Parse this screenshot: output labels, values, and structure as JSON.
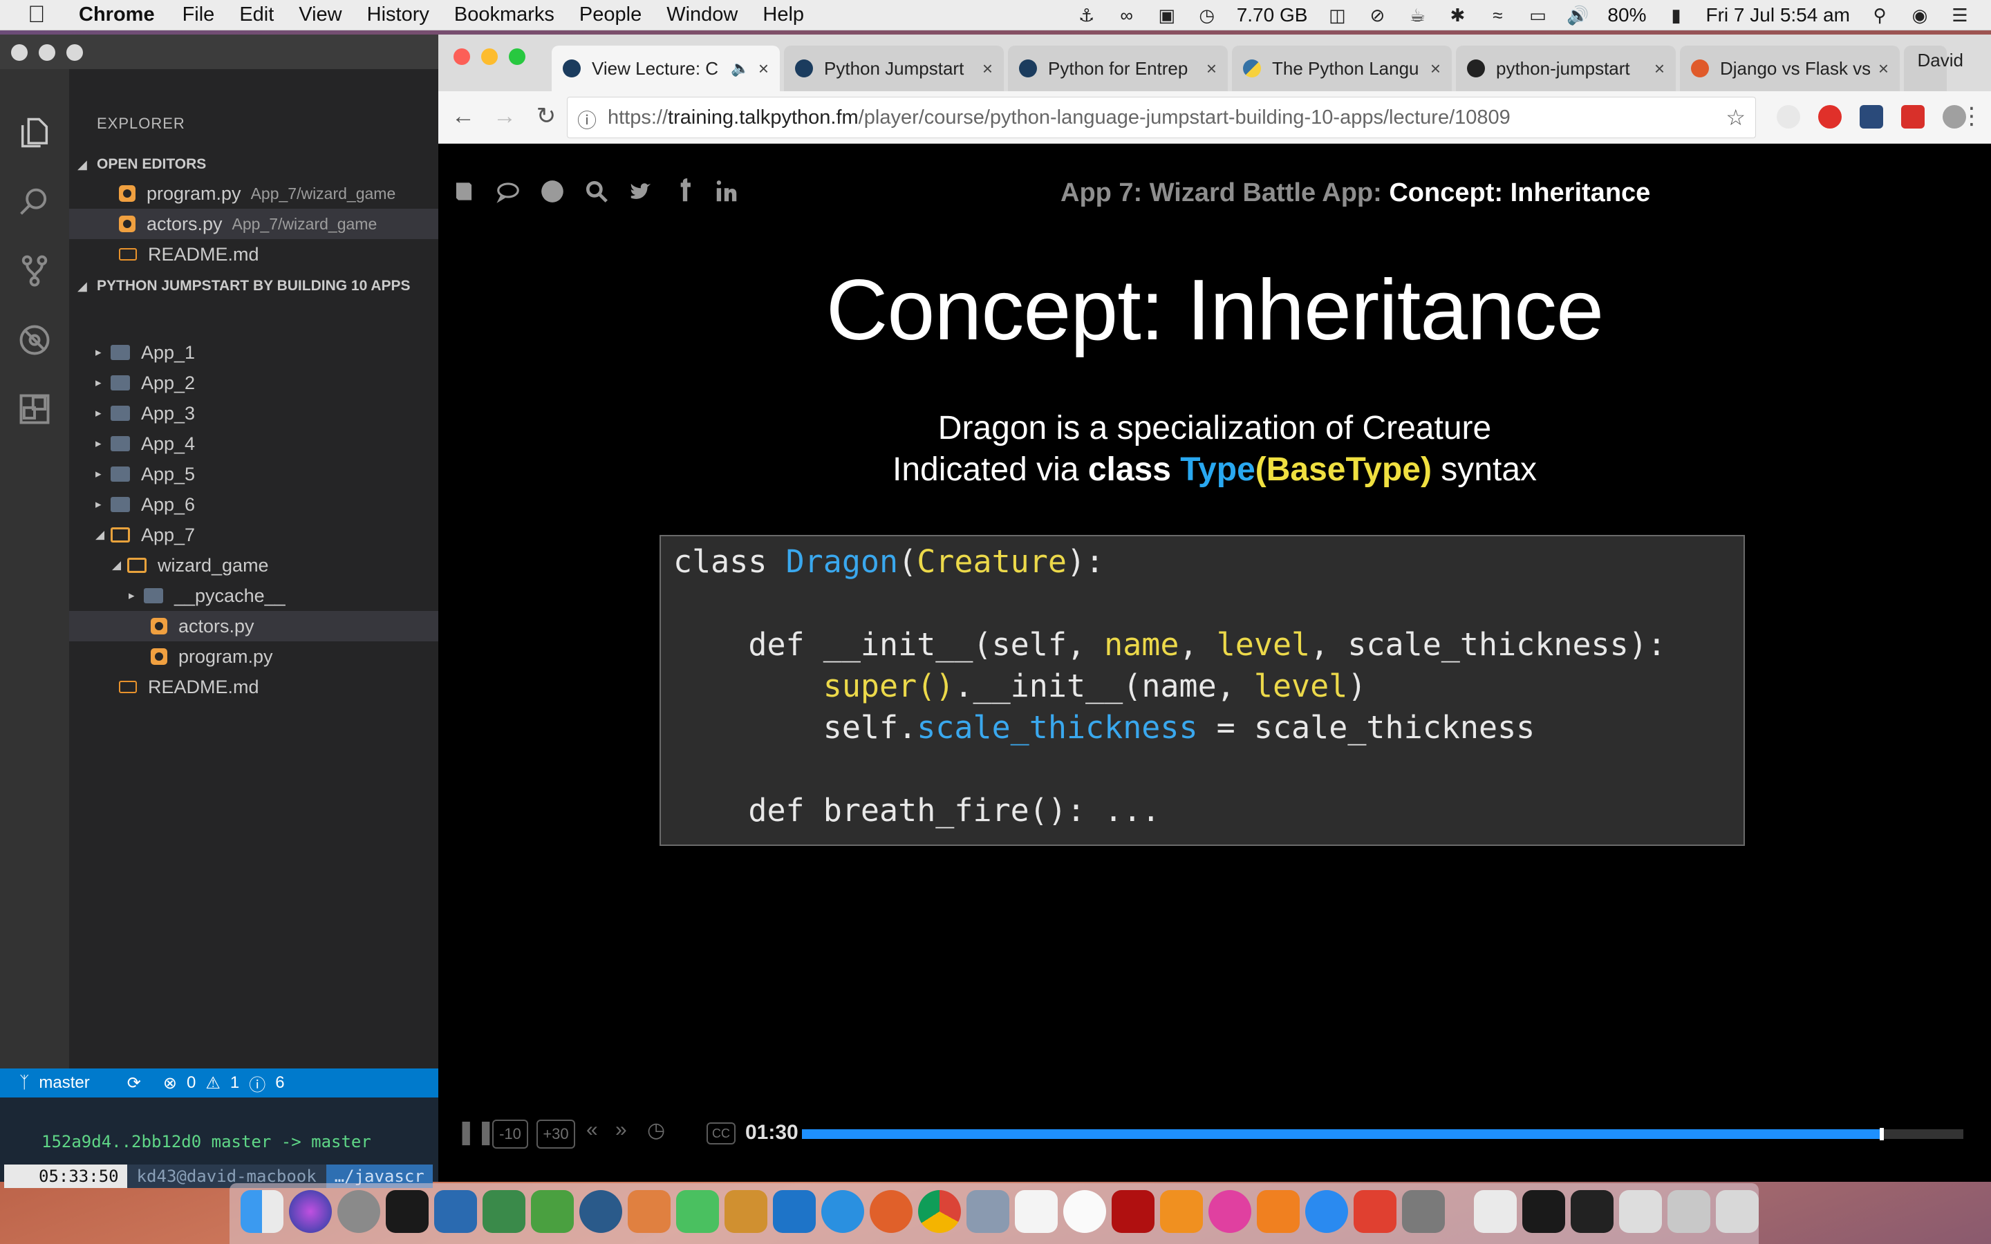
{
  "menubar": {
    "app_name": "Chrome",
    "menus": [
      "File",
      "Edit",
      "View",
      "History",
      "Bookmarks",
      "People",
      "Window",
      "Help"
    ],
    "memory": "7.70 GB",
    "battery": "80%",
    "clock": "Fri 7 Jul  5:54 am"
  },
  "vscode": {
    "explorer_title": "EXPLORER",
    "open_editors_title": "OPEN EDITORS",
    "open_editors": [
      {
        "name": "program.py",
        "hint": "App_7/wizard_game"
      },
      {
        "name": "actors.py",
        "hint": "App_7/wizard_game"
      },
      {
        "name": "README.md",
        "hint": ""
      }
    ],
    "project_title": "PYTHON JUMPSTART BY BUILDING 10 APPS",
    "tree": [
      "App_1",
      "App_2",
      "App_3",
      "App_4",
      "App_5",
      "App_6",
      "App_7",
      "wizard_game",
      "__pycache__",
      "actors.py",
      "program.py",
      "README.md"
    ],
    "status": {
      "branch": "master",
      "errors": "0",
      "warnings": "1",
      "infos": "6"
    },
    "terminal": {
      "line": "152a9d4..2bb12d0  master -> master",
      "time": "05:33:50",
      "user": "kd43@david-macbook",
      "path": "…/javascr"
    }
  },
  "chrome": {
    "profile": "David",
    "tabs": [
      {
        "label": "View Lecture: C",
        "active": true
      },
      {
        "label": "Python Jumpstart",
        "active": false
      },
      {
        "label": "Python for Entrep",
        "active": false
      },
      {
        "label": "The Python Langu",
        "active": false
      },
      {
        "label": "python-jumpstart",
        "active": false
      },
      {
        "label": "Django vs Flask vs",
        "active": false
      }
    ],
    "url_prefix": "https://",
    "url_host": "training.talkpython.fm",
    "url_path": "/player/course/python-language-jumpstart-building-10-apps/lecture/10809"
  },
  "page": {
    "course_title_prefix": "App 7: Wizard Battle App: ",
    "course_title_lecture": "Concept: Inheritance",
    "slide": {
      "title": "Concept: Inheritance",
      "line1": "Dragon is a specialization of Creature",
      "line2_pre": "Indicated via ",
      "line2_class": "class",
      "line2_type": "Type",
      "line2_base": "(BaseType)",
      "line2_post": " syntax"
    },
    "code": {
      "l1_kw": "class ",
      "l1_name": "Dragon",
      "l1_open": "(",
      "l1_base": "Creature",
      "l1_close": "):",
      "l2_a": "    def __init__(self, ",
      "l2_name": "name",
      "l2_comma1": ", ",
      "l2_level": "level",
      "l2_rest": ", scale_thickness):",
      "l3_super": "        super()",
      "l3_rest": ".__init__(name, ",
      "l3_level": "level",
      "l3_close": ")",
      "l4_a": "        self.",
      "l4_attr": "scale_thickness",
      "l4_rest": " = scale_thickness",
      "l5": "    def breath_fire(): ..."
    },
    "player": {
      "back_label": "-10",
      "fwd_label": "+30",
      "cc_label": "CC",
      "time": "01:30",
      "progress": 0.93
    }
  },
  "colors": {
    "accent_blue": "#007acc",
    "progress_blue": "#1e90ff",
    "code_blue": "#3aa8ee",
    "code_yellow": "#ecd94a"
  }
}
